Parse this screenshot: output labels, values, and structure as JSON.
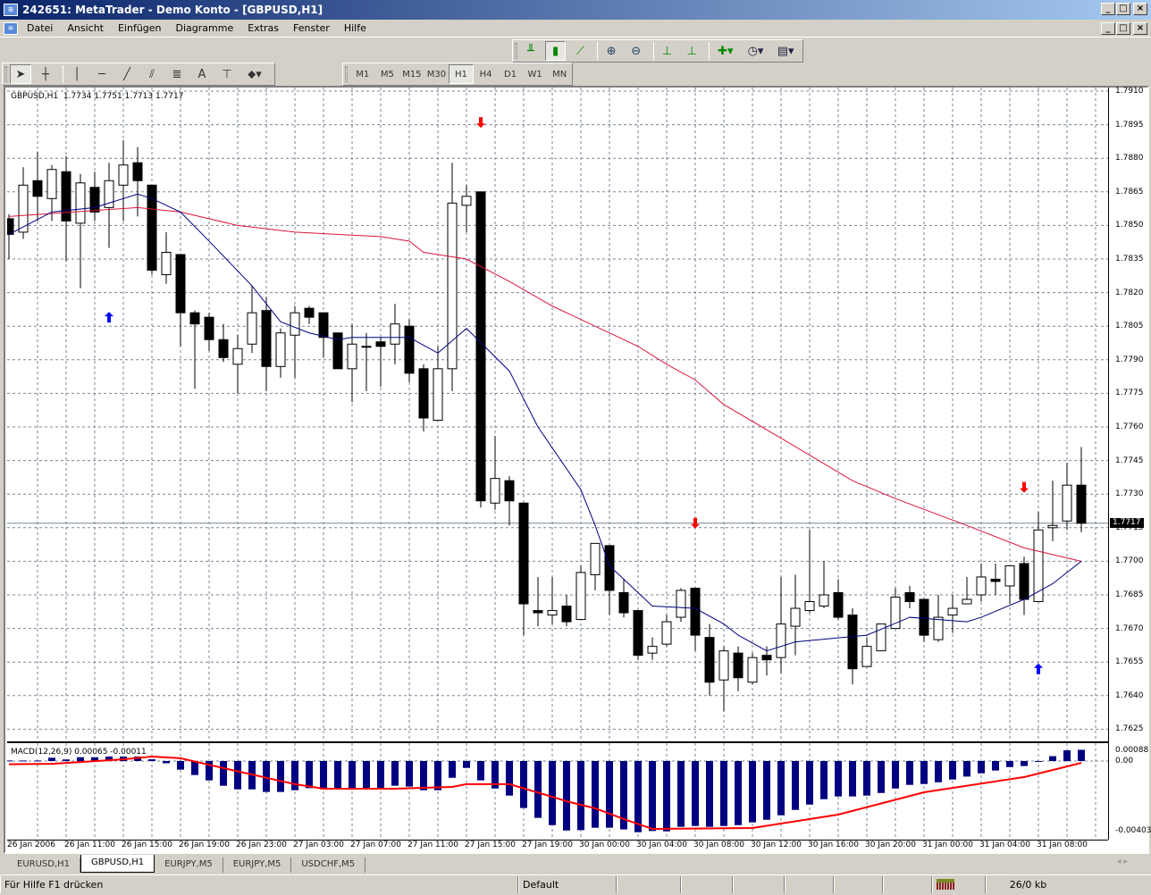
{
  "window": {
    "title": "242651: MetaTrader - Demo Konto - [GBPUSD,H1]",
    "min": "_",
    "max": "□",
    "close": "×"
  },
  "menu": [
    "Datei",
    "Ansicht",
    "Einfügen",
    "Diagramme",
    "Extras",
    "Fenster",
    "Hilfe"
  ],
  "timeframes": [
    "M1",
    "M5",
    "M15",
    "M30",
    "H1",
    "H4",
    "D1",
    "W1",
    "MN"
  ],
  "active_timeframe": "H1",
  "chart": {
    "symbol": "GBPUSD,H1",
    "ohlc": "1.7734 1.7751 1.7713 1.7717",
    "current_price": "1.7717"
  },
  "macd": {
    "label": "MACD(12,26,9) 0.00065 -0.00011",
    "axis": [
      "0.00088",
      "0.00",
      "-0.00403"
    ]
  },
  "tabs": [
    "EURUSD,H1",
    "GBPUSD,H1",
    "EURJPY,M5",
    "EURJPY,M5",
    "USDCHF,M5"
  ],
  "active_tab": "GBPUSD,H1",
  "status": {
    "help": "Für Hilfe F1 drücken",
    "profile": "Default",
    "traffic": "26/0 kb"
  },
  "colors": {
    "bull": "#ffffff",
    "bear": "#000000",
    "ma_fast": "#000080",
    "ma_slow": "#dc143c",
    "macd_hist": "#000080",
    "macd_signal": "#ff0000",
    "sell_arrow": "#ff0000",
    "buy_arrow": "#0000ff"
  },
  "chart_data": [
    {
      "type": "candlestick",
      "title": "GBPUSD,H1",
      "ylim": [
        1.7625,
        1.791
      ],
      "grid": true,
      "y_ticks": [
        "1.7910",
        "1.7895",
        "1.7880",
        "1.7865",
        "1.7850",
        "1.7835",
        "1.7820",
        "1.7805",
        "1.7790",
        "1.7775",
        "1.7760",
        "1.7745",
        "1.7730",
        "1.7715",
        "1.7700",
        "1.7685",
        "1.7670",
        "1.7655",
        "1.7640",
        "1.7625"
      ],
      "x_ticks": [
        "26 Jan 2006",
        "26 Jan 11:00",
        "26 Jan 15:00",
        "26 Jan 19:00",
        "26 Jan 23:00",
        "27 Jan 03:00",
        "27 Jan 07:00",
        "27 Jan 11:00",
        "27 Jan 15:00",
        "27 Jan 19:00",
        "30 Jan 00:00",
        "30 Jan 04:00",
        "30 Jan 08:00",
        "30 Jan 12:00",
        "30 Jan 16:00",
        "30 Jan 20:00",
        "31 Jan 00:00",
        "31 Jan 04:00",
        "31 Jan 08:00"
      ],
      "x_tick_every": 4,
      "ohlc": [
        [
          1.7853,
          1.7855,
          1.7835,
          1.7846
        ],
        [
          1.7847,
          1.7876,
          1.7844,
          1.7868
        ],
        [
          1.787,
          1.7883,
          1.7852,
          1.7863
        ],
        [
          1.7862,
          1.7877,
          1.7852,
          1.7875
        ],
        [
          1.7874,
          1.7881,
          1.7834,
          1.7852
        ],
        [
          1.7851,
          1.7873,
          1.7822,
          1.7869
        ],
        [
          1.7867,
          1.7874,
          1.7852,
          1.7856
        ],
        [
          1.7858,
          1.7878,
          1.784,
          1.787
        ],
        [
          1.7868,
          1.7888,
          1.7852,
          1.7877
        ],
        [
          1.7878,
          1.7885,
          1.7854,
          1.787
        ],
        [
          1.7868,
          1.7868,
          1.7828,
          1.783
        ],
        [
          1.7828,
          1.7847,
          1.7824,
          1.7838
        ],
        [
          1.7837,
          1.7837,
          1.7796,
          1.7811
        ],
        [
          1.7811,
          1.7812,
          1.7777,
          1.7806
        ],
        [
          1.7809,
          1.7811,
          1.7794,
          1.7799
        ],
        [
          1.7799,
          1.7806,
          1.7789,
          1.7791
        ],
        [
          1.7788,
          1.7801,
          1.7775,
          1.7795
        ],
        [
          1.7797,
          1.7823,
          1.7793,
          1.7811
        ],
        [
          1.7812,
          1.7818,
          1.7776,
          1.7787
        ],
        [
          1.7787,
          1.7804,
          1.7782,
          1.7802
        ],
        [
          1.7801,
          1.7814,
          1.7782,
          1.7811
        ],
        [
          1.7813,
          1.7814,
          1.7806,
          1.7809
        ],
        [
          1.7811,
          1.7811,
          1.7791,
          1.78
        ],
        [
          1.7802,
          1.7802,
          1.7786,
          1.7786
        ],
        [
          1.7786,
          1.7806,
          1.7771,
          1.7797
        ],
        [
          1.7796,
          1.7802,
          1.7776,
          1.7796
        ],
        [
          1.7798,
          1.78,
          1.7778,
          1.7796
        ],
        [
          1.7797,
          1.7815,
          1.7788,
          1.7806
        ],
        [
          1.7805,
          1.7808,
          1.778,
          1.7784
        ],
        [
          1.7786,
          1.7788,
          1.7758,
          1.7764
        ],
        [
          1.7763,
          1.7796,
          1.7763,
          1.7786
        ],
        [
          1.7786,
          1.7878,
          1.7776,
          1.786
        ],
        [
          1.7859,
          1.7868,
          1.7847,
          1.7863
        ],
        [
          1.7865,
          1.7865,
          1.7724,
          1.7727
        ],
        [
          1.7726,
          1.7756,
          1.7723,
          1.7737
        ],
        [
          1.7736,
          1.7738,
          1.7716,
          1.7727
        ],
        [
          1.7726,
          1.7726,
          1.7667,
          1.7681
        ],
        [
          1.7678,
          1.7693,
          1.7671,
          1.7677
        ],
        [
          1.7676,
          1.7693,
          1.7672,
          1.7678
        ],
        [
          1.768,
          1.7685,
          1.7671,
          1.7673
        ],
        [
          1.7674,
          1.7698,
          1.7674,
          1.7695
        ],
        [
          1.7694,
          1.7708,
          1.7687,
          1.7708
        ],
        [
          1.7707,
          1.7707,
          1.7676,
          1.7687
        ],
        [
          1.7686,
          1.7692,
          1.7675,
          1.7677
        ],
        [
          1.7678,
          1.7678,
          1.7656,
          1.7658
        ],
        [
          1.7659,
          1.7666,
          1.7656,
          1.7662
        ],
        [
          1.7663,
          1.7676,
          1.7662,
          1.7673
        ],
        [
          1.7675,
          1.7688,
          1.7673,
          1.7687
        ],
        [
          1.7688,
          1.7688,
          1.766,
          1.7667
        ],
        [
          1.7666,
          1.7672,
          1.764,
          1.7646
        ],
        [
          1.7647,
          1.7662,
          1.7633,
          1.766
        ],
        [
          1.7659,
          1.7662,
          1.7642,
          1.7648
        ],
        [
          1.7646,
          1.7659,
          1.7645,
          1.7657
        ],
        [
          1.7658,
          1.7662,
          1.7649,
          1.7656
        ],
        [
          1.7657,
          1.7693,
          1.765,
          1.7672
        ],
        [
          1.7671,
          1.7694,
          1.7658,
          1.7679
        ],
        [
          1.7678,
          1.7714,
          1.7677,
          1.7682
        ],
        [
          1.768,
          1.77,
          1.7679,
          1.7685
        ],
        [
          1.7686,
          1.7692,
          1.7674,
          1.7675
        ],
        [
          1.7676,
          1.7679,
          1.7645,
          1.7652
        ],
        [
          1.7653,
          1.7666,
          1.7653,
          1.7662
        ],
        [
          1.766,
          1.7672,
          1.766,
          1.7672
        ],
        [
          1.767,
          1.7688,
          1.767,
          1.7684
        ],
        [
          1.7686,
          1.7689,
          1.7679,
          1.7682
        ],
        [
          1.7683,
          1.7683,
          1.7664,
          1.7667
        ],
        [
          1.7665,
          1.7685,
          1.7664,
          1.7675
        ],
        [
          1.7676,
          1.7685,
          1.7668,
          1.7679
        ],
        [
          1.7681,
          1.7693,
          1.7681,
          1.7683
        ],
        [
          1.7685,
          1.7699,
          1.7682,
          1.7693
        ],
        [
          1.7692,
          1.7699,
          1.7685,
          1.7691
        ],
        [
          1.7689,
          1.7698,
          1.7681,
          1.7698
        ],
        [
          1.7699,
          1.7702,
          1.7676,
          1.7683
        ],
        [
          1.7682,
          1.7722,
          1.7682,
          1.7714
        ],
        [
          1.7715,
          1.7736,
          1.7709,
          1.7716
        ],
        [
          1.7718,
          1.7744,
          1.7714,
          1.7734
        ],
        [
          1.7734,
          1.7751,
          1.7713,
          1.7717
        ]
      ],
      "ma_fast": [
        [
          0,
          1.7846
        ],
        [
          3,
          1.7856
        ],
        [
          6,
          1.7858
        ],
        [
          9,
          1.7864
        ],
        [
          10,
          1.7862
        ],
        [
          12,
          1.7856
        ],
        [
          14,
          1.7843
        ],
        [
          17,
          1.7823
        ],
        [
          19,
          1.7807
        ],
        [
          21,
          1.7802
        ],
        [
          23,
          1.7799
        ],
        [
          24,
          1.78
        ],
        [
          28,
          1.78
        ],
        [
          30,
          1.7793
        ],
        [
          32,
          1.7804
        ],
        [
          35,
          1.7785
        ],
        [
          37,
          1.776
        ],
        [
          40,
          1.7732
        ],
        [
          41,
          1.7716
        ],
        [
          42,
          1.7698
        ],
        [
          45,
          1.768
        ],
        [
          48,
          1.7679
        ],
        [
          50,
          1.7672
        ],
        [
          51,
          1.7667
        ],
        [
          53,
          1.766
        ],
        [
          55,
          1.7664
        ],
        [
          60,
          1.7667
        ],
        [
          63,
          1.7675
        ],
        [
          67,
          1.7673
        ],
        [
          68,
          1.7675
        ],
        [
          71,
          1.7683
        ],
        [
          73,
          1.769
        ],
        [
          75,
          1.77
        ]
      ],
      "ma_slow": [
        [
          0,
          1.7854
        ],
        [
          9,
          1.7858
        ],
        [
          12,
          1.7856
        ],
        [
          16,
          1.785
        ],
        [
          20,
          1.7847
        ],
        [
          26,
          1.7845
        ],
        [
          28,
          1.7843
        ],
        [
          29,
          1.7838
        ],
        [
          32,
          1.7835
        ],
        [
          35,
          1.7825
        ],
        [
          38,
          1.7814
        ],
        [
          42,
          1.7802
        ],
        [
          44,
          1.7796
        ],
        [
          46,
          1.7788
        ],
        [
          48,
          1.7781
        ],
        [
          50,
          1.777
        ],
        [
          54,
          1.7755
        ],
        [
          59,
          1.7736
        ],
        [
          62,
          1.7728
        ],
        [
          67,
          1.7716
        ],
        [
          71,
          1.7706
        ],
        [
          75,
          1.77
        ]
      ],
      "signals": [
        {
          "bar": 7,
          "dir": "buy",
          "price": 1.7809
        },
        {
          "bar": 33,
          "dir": "sell",
          "price": 1.7896
        },
        {
          "bar": 48,
          "dir": "sell",
          "price": 1.7717
        },
        {
          "bar": 71,
          "dir": "sell",
          "price": 1.7733
        },
        {
          "bar": 72,
          "dir": "buy",
          "price": 1.7652
        }
      ]
    },
    {
      "type": "bar",
      "title": "MACD(12,26,9)",
      "ylim": [
        -0.00403,
        0.00088
      ],
      "histogram": [
        3e-05,
        3e-05,
        3e-05,
        0.00019,
        9e-05,
        0.00022,
        0.00022,
        0.00027,
        0.0004,
        0.00041,
        0.0001,
        -0.00013,
        -0.0005,
        -0.00081,
        -0.00112,
        -0.00143,
        -0.00164,
        -0.00164,
        -0.00179,
        -0.00179,
        -0.00169,
        -0.00157,
        -0.00164,
        -0.00164,
        -0.00164,
        -0.00164,
        -0.00164,
        -0.00143,
        -0.00148,
        -0.00169,
        -0.00169,
        -0.00097,
        -0.0004,
        -0.00112,
        -0.00159,
        -0.002,
        -0.00272,
        -0.00329,
        -0.00371,
        -0.00402,
        -0.004,
        -0.00386,
        -0.00386,
        -0.00396,
        -0.00412,
        -0.00405,
        -0.00407,
        -0.00381,
        -0.00376,
        -0.00381,
        -0.00376,
        -0.00371,
        -0.00355,
        -0.0034,
        -0.00314,
        -0.00283,
        -0.00252,
        -0.00221,
        -0.00205,
        -0.00205,
        -0.002,
        -0.00185,
        -0.00159,
        -0.00138,
        -0.00133,
        -0.00123,
        -0.00107,
        -0.0009,
        -0.00071,
        -0.00055,
        -0.00035,
        -0.00029,
        -2e-05,
        0.00028,
        0.00062,
        0.00065
      ],
      "signal": [
        [
          0,
          -0.00019
        ],
        [
          3,
          -0.00016
        ],
        [
          8,
          0.0001
        ],
        [
          10,
          0.00026
        ],
        [
          12,
          0.00016
        ],
        [
          15,
          -0.00041
        ],
        [
          20,
          -0.00134
        ],
        [
          22,
          -0.0016
        ],
        [
          27,
          -0.0016
        ],
        [
          31,
          -0.0015
        ],
        [
          32,
          -0.00134
        ],
        [
          35,
          -0.00134
        ],
        [
          38,
          -0.00207
        ],
        [
          39,
          -0.00233
        ],
        [
          41,
          -0.00274
        ],
        [
          43,
          -0.00336
        ],
        [
          45,
          -0.00393
        ],
        [
          52,
          -0.00388
        ],
        [
          58,
          -0.0031
        ],
        [
          64,
          -0.00181
        ],
        [
          71,
          -0.00093
        ],
        [
          75,
          -0.00011
        ]
      ]
    }
  ]
}
